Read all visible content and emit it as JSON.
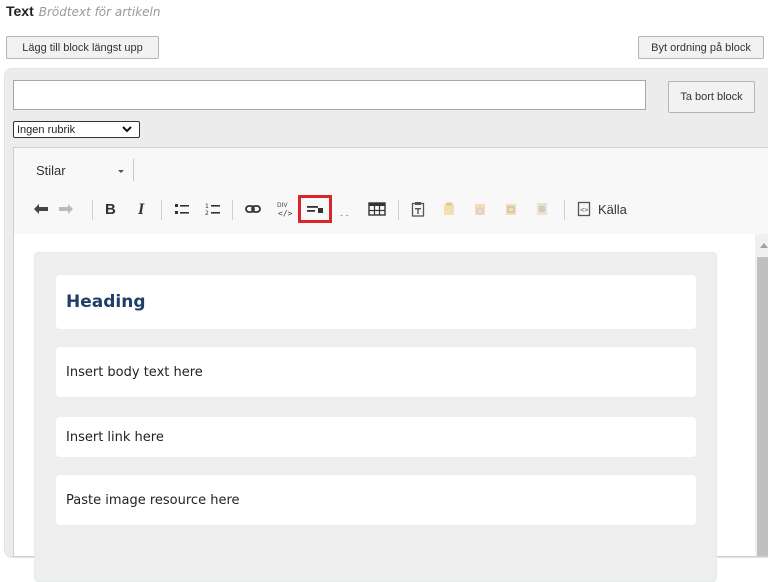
{
  "header": {
    "title": "Text",
    "subtitle": "Brödtext för artikeln"
  },
  "buttons": {
    "add_top": "Lägg till block längst upp",
    "reorder": "Byt ordning på block",
    "remove": "Ta bort block"
  },
  "block_title_input": {
    "value": ""
  },
  "heading_select": {
    "selected": "Ingen rubrik"
  },
  "editor": {
    "styles_combo": "Stilar",
    "toolbar_icons": [
      "undo-icon",
      "redo-icon",
      "bold-icon",
      "italic-icon",
      "bulleted-list-icon",
      "numbered-list-icon",
      "link-icon",
      "div-container-icon",
      "component-icon",
      "blockquote-icon",
      "table-icon",
      "paste-icon",
      "paste-text-icon",
      "paste-word-icon",
      "template-icon",
      "image-icon",
      "source-icon"
    ],
    "source_label": "Källa",
    "highlight_color": "#d8252a",
    "blocks": [
      {
        "text": "Heading"
      },
      {
        "text": "Insert body text here"
      },
      {
        "text": "Insert link here"
      },
      {
        "text": "Paste image resource here"
      }
    ]
  }
}
